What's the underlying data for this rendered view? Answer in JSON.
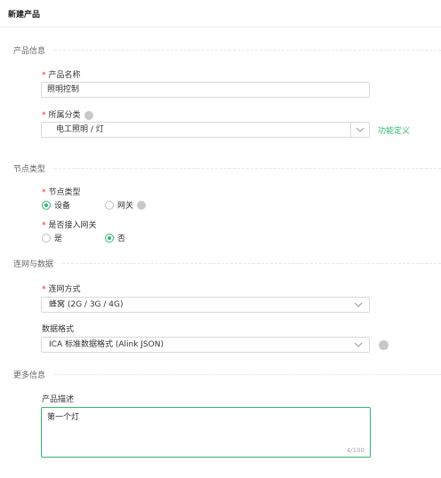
{
  "page": {
    "title": "新建产品"
  },
  "sections": {
    "product_info": "产品信息",
    "node_type": "节点类型",
    "network_data": "连网与数据",
    "more_info": "更多信息"
  },
  "product_name": {
    "label": "产品名称",
    "value": "照明控制"
  },
  "category": {
    "label": "所属分类",
    "value": "电工照明 / 灯",
    "link": "功能定义"
  },
  "node_type": {
    "label": "节点类型",
    "options": [
      {
        "label": "设备",
        "checked": true
      },
      {
        "label": "网关",
        "checked": false
      }
    ]
  },
  "gateway_access": {
    "label": "是否接入网关",
    "options": [
      {
        "label": "是",
        "checked": false
      },
      {
        "label": "否",
        "checked": true
      }
    ]
  },
  "network_method": {
    "label": "连网方式",
    "value": "蜂窝 (2G / 3G / 4G)"
  },
  "data_format": {
    "label": "数据格式",
    "value": "ICA 标准数据格式 (Alink JSON)"
  },
  "description": {
    "label": "产品描述",
    "value": "第一个灯",
    "counter": "4/100"
  },
  "colors": {
    "accent": "#2fb86b",
    "required": "#f5222d",
    "border": "#d9d9d9"
  },
  "icons": {
    "help": "help-dot-icon",
    "dropdown": "chevron-down-icon"
  }
}
